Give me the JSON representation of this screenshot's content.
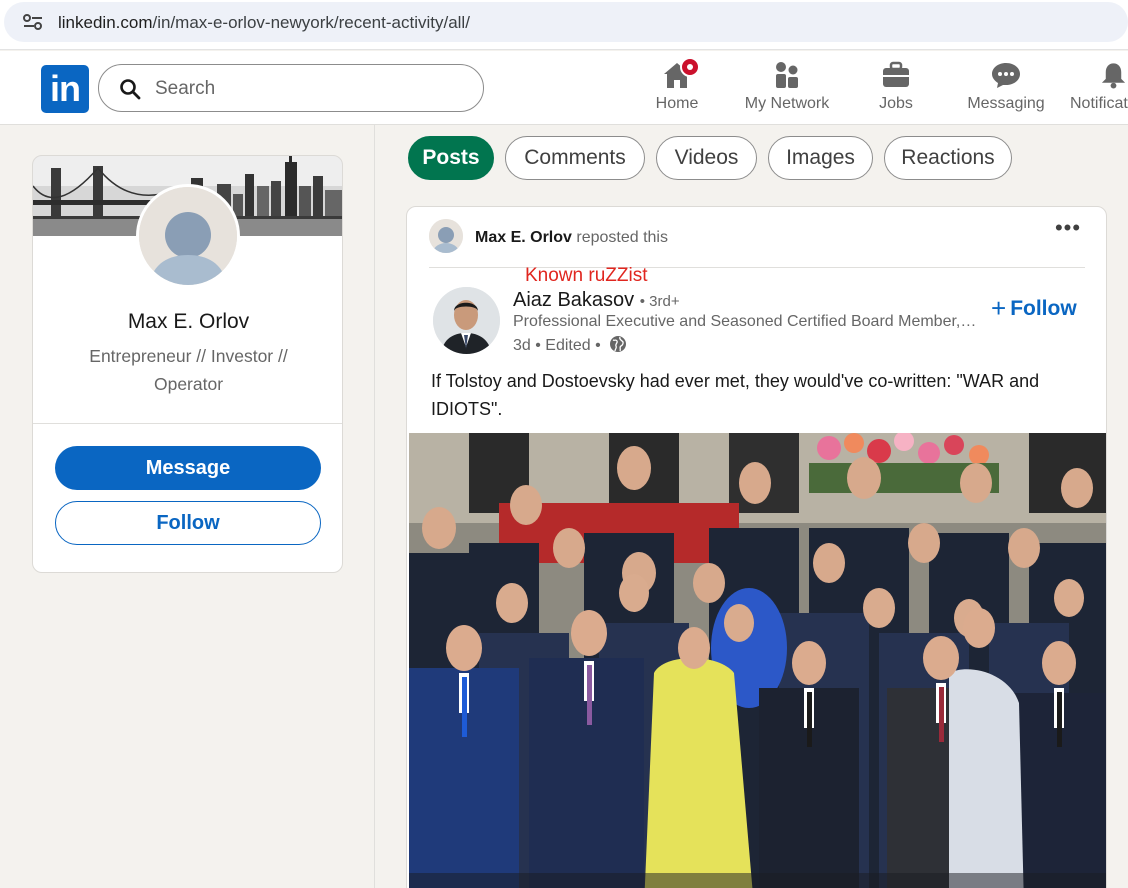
{
  "browser": {
    "url_host": "linkedin.com",
    "url_path": "/in/max-e-orlov-newyork/recent-activity/all/"
  },
  "nav": {
    "logo_text": "in",
    "search_placeholder": "Search",
    "items": [
      {
        "label": "Home",
        "icon": "home-icon",
        "badge": true
      },
      {
        "label": "My Network",
        "icon": "people-icon"
      },
      {
        "label": "Jobs",
        "icon": "briefcase-icon"
      },
      {
        "label": "Messaging",
        "icon": "chat-icon"
      },
      {
        "label": "Notifications",
        "icon": "bell-icon"
      }
    ]
  },
  "profile": {
    "name": "Max E. Orlov",
    "headline": "Entrepreneur // Investor // Operator",
    "message_label": "Message",
    "follow_label": "Follow"
  },
  "filters": [
    {
      "label": "Posts",
      "active": true
    },
    {
      "label": "Comments",
      "active": false
    },
    {
      "label": "Videos",
      "active": false
    },
    {
      "label": "Images",
      "active": false
    },
    {
      "label": "Reactions",
      "active": false
    }
  ],
  "post": {
    "reposter_name": "Max E. Orlov",
    "repost_text": "reposted this",
    "annotation": "Known ruZZist",
    "author_name": "Aiaz Bakasov",
    "author_degree": "• 3rd+",
    "author_headline": "Professional Executive and Seasoned Certified Board Member, Global Strategic Advisor",
    "author_meta": "3d • Edited •",
    "follow_label": "Follow",
    "text": "If Tolstoy and Dostoevsky had ever met, they would've co-written: \"WAR and IDIOTS\"."
  },
  "colors": {
    "brand": "#0a66c2",
    "active_pill": "#01754f",
    "annotation": "#e0261f",
    "badge": "#cb112d"
  }
}
